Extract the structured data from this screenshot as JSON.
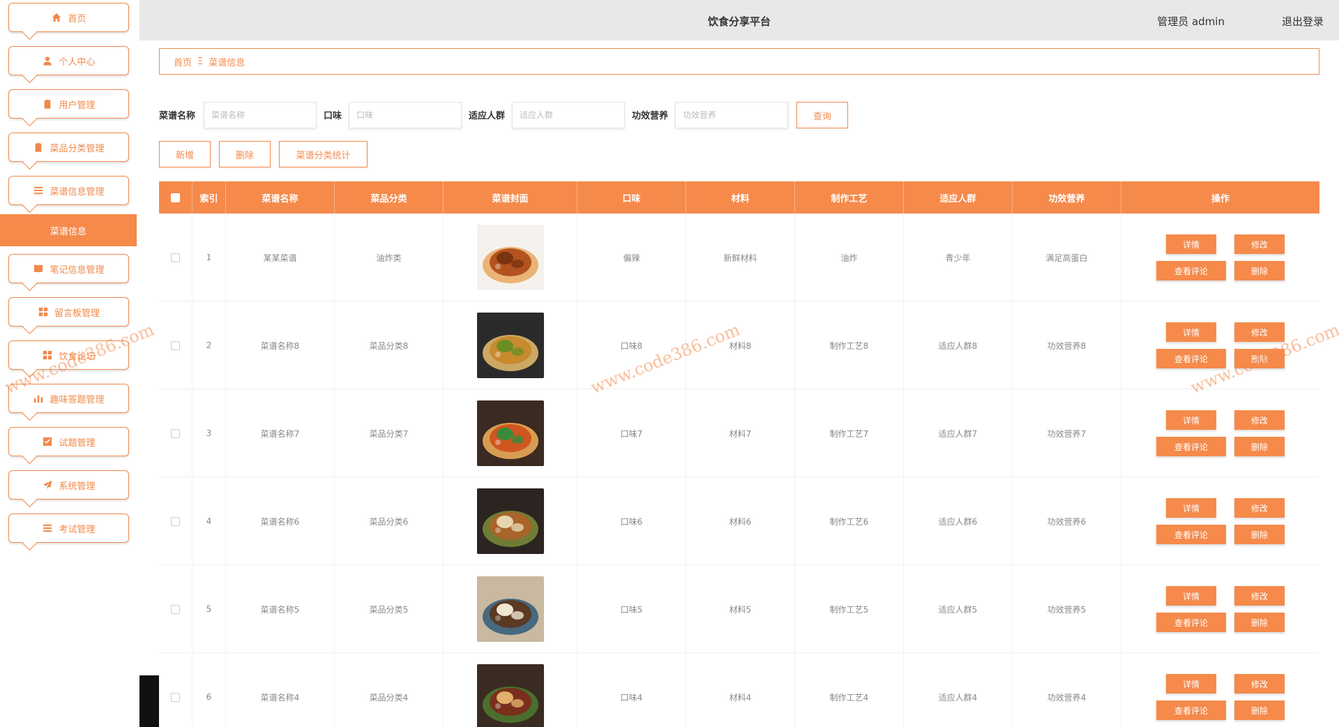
{
  "sidebar": {
    "items": [
      {
        "label": "首页",
        "icon": "home-icon"
      },
      {
        "label": "个人中心",
        "icon": "user-icon"
      },
      {
        "label": "用户管理",
        "icon": "clipboard-icon"
      },
      {
        "label": "菜品分类管理",
        "icon": "clipboard-icon"
      },
      {
        "label": "菜谱信息管理",
        "icon": "list-icon"
      },
      {
        "label": "笔记信息管理",
        "icon": "book-icon"
      },
      {
        "label": "留言板管理",
        "icon": "grid-icon"
      },
      {
        "label": "饮食论坛",
        "icon": "grid-icon"
      },
      {
        "label": "趣味答题管理",
        "icon": "bar-chart-icon"
      },
      {
        "label": "试题管理",
        "icon": "check-square-icon"
      },
      {
        "label": "系统管理",
        "icon": "send-icon"
      },
      {
        "label": "考试管理",
        "icon": "list-icon"
      }
    ],
    "active_sub": "菜谱信息"
  },
  "header": {
    "title": "饮食分享平台",
    "user": "管理员 admin",
    "logout": "退出登录"
  },
  "breadcrumb": {
    "home": "首页",
    "separator": "Ξ",
    "current": "菜谱信息"
  },
  "search": {
    "name_label": "菜谱名称",
    "name_placeholder": "菜谱名称",
    "taste_label": "口味",
    "taste_placeholder": "口味",
    "crowd_label": "适应人群",
    "crowd_placeholder": "适应人群",
    "effect_label": "功效营养",
    "effect_placeholder": "功效营养",
    "query_button": "查询"
  },
  "toolbar": {
    "add": "新增",
    "delete": "删除",
    "stats": "菜谱分类统计"
  },
  "table": {
    "columns": [
      "索引",
      "菜谱名称",
      "菜品分类",
      "菜谱封面",
      "口味",
      "材料",
      "制作工艺",
      "适应人群",
      "功效营养",
      "操作"
    ],
    "rows": [
      {
        "index": "1",
        "name": "某某菜谱",
        "category": "油炸类",
        "taste": "偏辣",
        "material": "新鲜材料",
        "craft": "油炸",
        "crowd": "青少年",
        "effect": "满足高蛋白"
      },
      {
        "index": "2",
        "name": "菜谱名称8",
        "category": "菜品分类8",
        "taste": "口味8",
        "material": "材料8",
        "craft": "制作工艺8",
        "crowd": "适应人群8",
        "effect": "功效营养8"
      },
      {
        "index": "3",
        "name": "菜谱名称7",
        "category": "菜品分类7",
        "taste": "口味7",
        "material": "材料7",
        "craft": "制作工艺7",
        "crowd": "适应人群7",
        "effect": "功效营养7"
      },
      {
        "index": "4",
        "name": "菜谱名称6",
        "category": "菜品分类6",
        "taste": "口味6",
        "material": "材料6",
        "craft": "制作工艺6",
        "crowd": "适应人群6",
        "effect": "功效营养6"
      },
      {
        "index": "5",
        "name": "菜谱名称5",
        "category": "菜品分类5",
        "taste": "口味5",
        "material": "材料5",
        "craft": "制作工艺5",
        "crowd": "适应人群5",
        "effect": "功效营养5"
      },
      {
        "index": "6",
        "name": "菜谱名称4",
        "category": "菜品分类4",
        "taste": "口味4",
        "material": "材料4",
        "craft": "制作工艺4",
        "crowd": "适应人群4",
        "effect": "功效营养4"
      }
    ],
    "ops": {
      "detail": "详情",
      "edit": "修改",
      "comments": "查看评论",
      "delete": "删除"
    }
  },
  "watermark": "www.code386.com",
  "colors": {
    "accent": "#f58a4b",
    "header_bg": "#e8e8e8"
  }
}
